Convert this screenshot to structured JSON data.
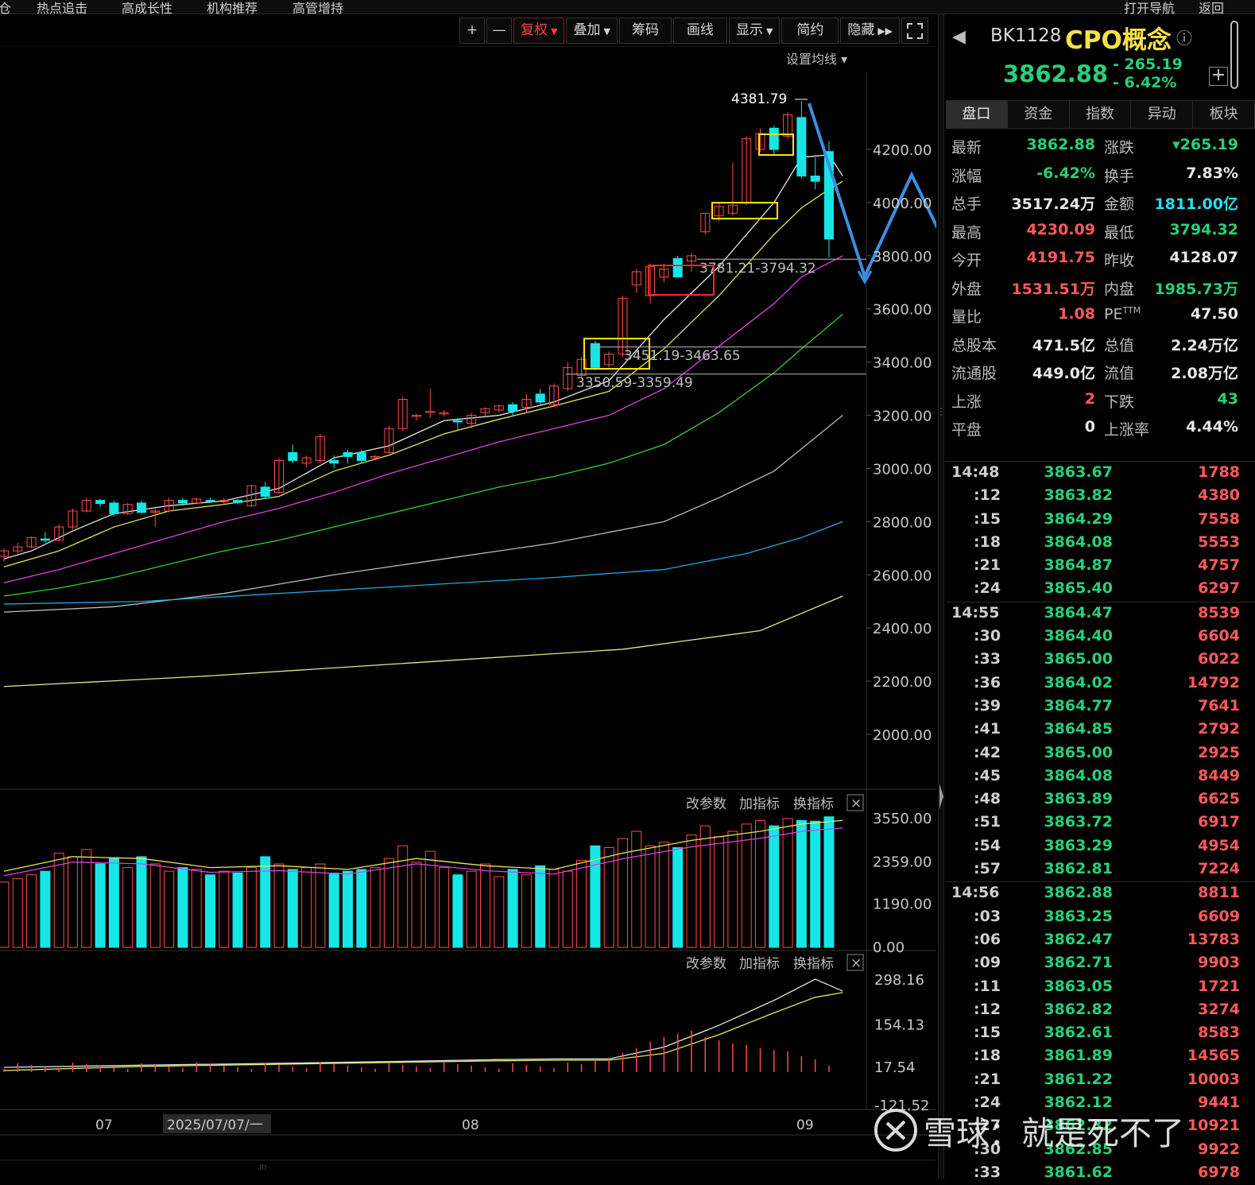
{
  "top_nav": [
    "仓",
    "热点追击",
    "高成长性",
    "机构推荐",
    "高管增持",
    "打开导航",
    "返回"
  ],
  "toolbar": {
    "plus": "+",
    "minus": "—",
    "fuquan": "复权",
    "overlay": "叠加",
    "chips": "筹码",
    "draw": "画线",
    "display": "显示",
    "simple": "简约",
    "hide": "隐藏"
  },
  "main_chart": {
    "set_ma_label": "设置均线",
    "high_label": "4381.79",
    "zone_labels": [
      "3781.21-3794.32",
      "3451.19-3463.65",
      "3350.59-3359.49"
    ],
    "y_ticks": [
      "4200.00",
      "4000.00",
      "3800.00",
      "3600.00",
      "3400.00",
      "3200.00",
      "3000.00",
      "2800.00",
      "2600.00",
      "2400.00",
      "2200.00",
      "2000.00"
    ],
    "x_labels": [
      "07",
      "2025/07/07/一",
      "08",
      "09"
    ]
  },
  "sub_controls": {
    "change_params": "改参数",
    "add_indicator": "加指标",
    "switch_indicator": "换指标",
    "close": "×"
  },
  "volume_panel": {
    "y_ticks": [
      "3550.00",
      "2359.00",
      "1190.00",
      "0.00"
    ]
  },
  "macd_panel": {
    "y_ticks": [
      "298.16",
      "154.13",
      "17.54",
      "-121.52"
    ]
  },
  "chart_data": {
    "type": "candlestick",
    "ylim": [
      1900,
      4450
    ],
    "candles": [
      [
        2670,
        2700,
        2650,
        2690
      ],
      [
        2690,
        2720,
        2680,
        2705
      ],
      [
        2705,
        2745,
        2700,
        2740
      ],
      [
        2735,
        2760,
        2720,
        2730
      ],
      [
        2730,
        2790,
        2725,
        2780
      ],
      [
        2780,
        2850,
        2770,
        2840
      ],
      [
        2840,
        2890,
        2835,
        2880
      ],
      [
        2880,
        2885,
        2855,
        2868
      ],
      [
        2870,
        2880,
        2820,
        2830
      ],
      [
        2830,
        2870,
        2825,
        2865
      ],
      [
        2870,
        2880,
        2830,
        2835
      ],
      [
        2835,
        2850,
        2780,
        2840
      ],
      [
        2840,
        2890,
        2835,
        2880
      ],
      [
        2880,
        2890,
        2860,
        2870
      ],
      [
        2870,
        2890,
        2865,
        2885
      ],
      [
        2880,
        2890,
        2870,
        2875
      ],
      [
        2875,
        2890,
        2865,
        2880
      ],
      [
        2880,
        2885,
        2865,
        2872
      ],
      [
        2860,
        2940,
        2855,
        2935
      ],
      [
        2930,
        2950,
        2885,
        2895
      ],
      [
        2910,
        3040,
        2905,
        3030
      ],
      [
        3060,
        3090,
        3020,
        3030
      ],
      [
        3020,
        3050,
        3005,
        3040
      ],
      [
        3030,
        3130,
        3020,
        3120
      ],
      [
        3030,
        3050,
        3000,
        3020
      ],
      [
        3060,
        3070,
        3020,
        3045
      ],
      [
        3060,
        3070,
        3020,
        3030
      ],
      [
        3040,
        3050,
        3030,
        3045
      ],
      [
        3060,
        3160,
        3055,
        3150
      ],
      [
        3150,
        3270,
        3140,
        3260
      ],
      [
        3200,
        3205,
        3180,
        3200
      ],
      [
        3210,
        3300,
        3190,
        3215
      ],
      [
        3205,
        3220,
        3195,
        3210
      ],
      [
        3180,
        3190,
        3140,
        3175
      ],
      [
        3170,
        3210,
        3150,
        3200
      ],
      [
        3210,
        3230,
        3195,
        3225
      ],
      [
        3220,
        3240,
        3210,
        3235
      ],
      [
        3240,
        3250,
        3200,
        3215
      ],
      [
        3230,
        3280,
        3210,
        3260
      ],
      [
        3280,
        3300,
        3240,
        3250
      ],
      [
        3240,
        3320,
        3230,
        3310
      ],
      [
        3300,
        3400,
        3290,
        3380
      ],
      [
        3350,
        3420,
        3340,
        3410
      ],
      [
        3470,
        3480,
        3370,
        3380
      ],
      [
        3390,
        3440,
        3380,
        3430
      ],
      [
        3430,
        3650,
        3420,
        3640
      ],
      [
        3690,
        3750,
        3660,
        3740
      ],
      [
        3650,
        3770,
        3620,
        3760
      ],
      [
        3720,
        3770,
        3700,
        3750
      ],
      [
        3790,
        3800,
        3720,
        3720
      ],
      [
        3780,
        3810,
        3740,
        3800
      ],
      [
        3890,
        3960,
        3880,
        3960
      ],
      [
        3950,
        4000,
        3930,
        3985
      ],
      [
        3960,
        4150,
        3950,
        3990
      ],
      [
        4000,
        4250,
        3990,
        4240
      ],
      [
        4200,
        4280,
        4190,
        4260
      ],
      [
        4280,
        4290,
        4180,
        4200
      ],
      [
        4250,
        4340,
        4240,
        4330
      ],
      [
        4320,
        4381.79,
        4090,
        4100
      ],
      [
        4100,
        4170,
        4050,
        4080
      ],
      [
        4191.75,
        4230.09,
        3794.32,
        3862.88
      ]
    ],
    "ma": [
      {
        "name": "MA5",
        "color": "#e6e6e6",
        "values": [
          [
            0,
            2660
          ],
          [
            2,
            2690
          ],
          [
            5,
            2765
          ],
          [
            8,
            2830
          ],
          [
            12,
            2860
          ],
          [
            16,
            2878
          ],
          [
            20,
            2925
          ],
          [
            24,
            3040
          ],
          [
            28,
            3085
          ],
          [
            32,
            3180
          ],
          [
            36,
            3200
          ],
          [
            40,
            3250
          ],
          [
            44,
            3330
          ],
          [
            48,
            3560
          ],
          [
            52,
            3760
          ],
          [
            56,
            4000
          ],
          [
            58,
            4170
          ],
          [
            60,
            4180
          ],
          [
            61,
            4100
          ]
        ]
      },
      {
        "name": "MA10",
        "color": "#e6e65a",
        "values": [
          [
            0,
            2630
          ],
          [
            4,
            2690
          ],
          [
            8,
            2780
          ],
          [
            12,
            2840
          ],
          [
            16,
            2865
          ],
          [
            20,
            2895
          ],
          [
            24,
            2990
          ],
          [
            28,
            3050
          ],
          [
            32,
            3130
          ],
          [
            36,
            3185
          ],
          [
            40,
            3235
          ],
          [
            44,
            3290
          ],
          [
            48,
            3450
          ],
          [
            52,
            3650
          ],
          [
            56,
            3880
          ],
          [
            58,
            3980
          ],
          [
            60,
            4050
          ],
          [
            61,
            4080
          ]
        ]
      },
      {
        "name": "MA20",
        "color": "#e040e0",
        "values": [
          [
            0,
            2570
          ],
          [
            4,
            2620
          ],
          [
            8,
            2680
          ],
          [
            12,
            2740
          ],
          [
            16,
            2800
          ],
          [
            20,
            2850
          ],
          [
            24,
            2910
          ],
          [
            28,
            2980
          ],
          [
            32,
            3040
          ],
          [
            36,
            3100
          ],
          [
            40,
            3150
          ],
          [
            44,
            3200
          ],
          [
            48,
            3300
          ],
          [
            52,
            3460
          ],
          [
            56,
            3620
          ],
          [
            58,
            3720
          ],
          [
            61,
            3800
          ]
        ]
      },
      {
        "name": "MA30",
        "color": "#2fd22f",
        "values": [
          [
            0,
            2520
          ],
          [
            4,
            2550
          ],
          [
            8,
            2590
          ],
          [
            12,
            2640
          ],
          [
            16,
            2690
          ],
          [
            20,
            2730
          ],
          [
            24,
            2780
          ],
          [
            28,
            2830
          ],
          [
            32,
            2880
          ],
          [
            36,
            2930
          ],
          [
            40,
            2970
          ],
          [
            44,
            3020
          ],
          [
            48,
            3090
          ],
          [
            52,
            3210
          ],
          [
            56,
            3360
          ],
          [
            58,
            3450
          ],
          [
            61,
            3580
          ]
        ]
      },
      {
        "name": "MA60",
        "color": "#bdbdbd",
        "values": [
          [
            0,
            2460
          ],
          [
            8,
            2480
          ],
          [
            16,
            2530
          ],
          [
            24,
            2600
          ],
          [
            32,
            2660
          ],
          [
            40,
            2720
          ],
          [
            48,
            2800
          ],
          [
            52,
            2890
          ],
          [
            56,
            2990
          ],
          [
            61,
            3200
          ]
        ]
      },
      {
        "name": "MA120",
        "color": "#1ea8e0",
        "values": [
          [
            0,
            2490
          ],
          [
            10,
            2500
          ],
          [
            20,
            2530
          ],
          [
            30,
            2560
          ],
          [
            40,
            2590
          ],
          [
            48,
            2620
          ],
          [
            54,
            2680
          ],
          [
            58,
            2740
          ],
          [
            61,
            2800
          ]
        ]
      },
      {
        "name": "MA250",
        "color": "#e6e68c",
        "values": [
          [
            0,
            2180
          ],
          [
            15,
            2220
          ],
          [
            30,
            2270
          ],
          [
            45,
            2320
          ],
          [
            55,
            2390
          ],
          [
            61,
            2520
          ]
        ]
      }
    ],
    "volume": [
      [
        1800
      ],
      [
        1900
      ],
      [
        2000
      ],
      [
        2100
      ],
      [
        2600
      ],
      [
        2500
      ],
      [
        2700
      ],
      [
        2300
      ],
      [
        2450
      ],
      [
        2200
      ],
      [
        2500
      ],
      [
        2300
      ],
      [
        2100
      ],
      [
        2200
      ],
      [
        2150
      ],
      [
        2000
      ],
      [
        2100
      ],
      [
        2050
      ],
      [
        2200
      ],
      [
        2500
      ],
      [
        2300
      ],
      [
        2150
      ],
      [
        2200
      ],
      [
        2300
      ],
      [
        2050
      ],
      [
        2100
      ],
      [
        2150
      ],
      [
        2200
      ],
      [
        2450
      ],
      [
        2800
      ],
      [
        2350
      ],
      [
        2650
      ],
      [
        2200
      ],
      [
        2000
      ],
      [
        2100
      ],
      [
        2300
      ],
      [
        1950
      ],
      [
        2150
      ],
      [
        2000
      ],
      [
        2250
      ],
      [
        2150
      ],
      [
        2100
      ],
      [
        2400
      ],
      [
        2800
      ],
      [
        2750
      ],
      [
        3000
      ],
      [
        3200
      ],
      [
        2800
      ],
      [
        2900
      ],
      [
        2750
      ],
      [
        3100
      ],
      [
        3350
      ],
      [
        3050
      ],
      [
        3200
      ],
      [
        3400
      ],
      [
        3500
      ],
      [
        3350
      ],
      [
        3550
      ],
      [
        3500
      ],
      [
        3480
      ],
      [
        3600
      ]
    ],
    "macd_lines": {
      "dif": [
        [
          0,
          15
        ],
        [
          10,
          22
        ],
        [
          20,
          28
        ],
        [
          30,
          35
        ],
        [
          36,
          40
        ],
        [
          40,
          42
        ],
        [
          44,
          42
        ],
        [
          48,
          80
        ],
        [
          52,
          150
        ],
        [
          56,
          230
        ],
        [
          59,
          298
        ],
        [
          61,
          260
        ]
      ],
      "dea": [
        [
          0,
          5
        ],
        [
          10,
          18
        ],
        [
          20,
          25
        ],
        [
          30,
          32
        ],
        [
          36,
          36
        ],
        [
          40,
          38
        ],
        [
          44,
          38
        ],
        [
          48,
          60
        ],
        [
          52,
          120
        ],
        [
          56,
          190
        ],
        [
          59,
          240
        ],
        [
          61,
          255
        ]
      ]
    }
  },
  "quote_panel": {
    "code": "BK1128",
    "name": "CPO概念",
    "price": "3862.88",
    "change": "- 265.19",
    "change_pct": "- 6.42%",
    "add_btn": "+",
    "tabs": [
      "盘口",
      "资金",
      "指数",
      "异动",
      "板块"
    ],
    "rows": [
      {
        "l1": "最新",
        "v1": "3862.88",
        "c1": "#26d07c",
        "l2": "涨跌",
        "v2": "▾265.19",
        "c2": "#26d07c"
      },
      {
        "l1": "涨幅",
        "v1": "-6.42%",
        "c1": "#26d07c",
        "l2": "换手",
        "v2": "7.83%",
        "c2": "#e8e8e8"
      },
      {
        "l1": "总手",
        "v1": "3517.24万",
        "c1": "#e8e8e8",
        "l2": "金额",
        "v2": "1811.00亿",
        "c2": "#27e0f0"
      },
      {
        "l1": "最高",
        "v1": "4230.09",
        "c1": "#ff5a5a",
        "l2": "最低",
        "v2": "3794.32",
        "c2": "#26d07c"
      },
      {
        "l1": "今开",
        "v1": "4191.75",
        "c1": "#ff5a5a",
        "l2": "昨收",
        "v2": "4128.07",
        "c2": "#e8e8e8"
      },
      {
        "l1": "外盘",
        "v1": "1531.51万",
        "c1": "#ff5a5a",
        "l2": "内盘",
        "v2": "1985.73万",
        "c2": "#26d07c"
      },
      {
        "l1": "量比",
        "v1": "1.08",
        "c1": "#ff5a5a",
        "l2": "PE",
        "l2sup": "TTM",
        "v2": "47.50",
        "c2": "#e8e8e8"
      },
      {
        "l1": "总股本",
        "v1": "471.5亿",
        "c1": "#e8e8e8",
        "l2": "总值",
        "v2": "2.24万亿",
        "c2": "#e8e8e8"
      },
      {
        "l1": "流通股",
        "v1": "449.0亿",
        "c1": "#e8e8e8",
        "l2": "流值",
        "v2": "2.08万亿",
        "c2": "#e8e8e8"
      },
      {
        "l1": "上涨",
        "v1": "2",
        "c1": "#ff5a5a",
        "l2": "下跌",
        "v2": "43",
        "c2": "#26d07c"
      },
      {
        "l1": "平盘",
        "v1": "0",
        "c1": "#e8e8e8",
        "l2": "上涨率",
        "v2": "4.44%",
        "c2": "#e8e8e8"
      }
    ],
    "ticks": [
      {
        "t": "14:48",
        "p": "3863.67",
        "v": "1788",
        "sep": false
      },
      {
        "t": ":12",
        "p": "3863.82",
        "v": "4380"
      },
      {
        "t": ":15",
        "p": "3864.29",
        "v": "7558"
      },
      {
        "t": ":18",
        "p": "3864.08",
        "v": "5553"
      },
      {
        "t": ":21",
        "p": "3864.87",
        "v": "4757"
      },
      {
        "t": ":24",
        "p": "3865.40",
        "v": "6297"
      },
      {
        "t": "14:55",
        "p": "3864.47",
        "v": "8539",
        "sep": true
      },
      {
        "t": ":30",
        "p": "3864.40",
        "v": "6604"
      },
      {
        "t": ":33",
        "p": "3865.00",
        "v": "6022"
      },
      {
        "t": ":36",
        "p": "3864.02",
        "v": "14792"
      },
      {
        "t": ":39",
        "p": "3864.77",
        "v": "7641"
      },
      {
        "t": ":41",
        "p": "3864.85",
        "v": "2792"
      },
      {
        "t": ":42",
        "p": "3865.00",
        "v": "2925"
      },
      {
        "t": ":45",
        "p": "3864.08",
        "v": "8449"
      },
      {
        "t": ":48",
        "p": "3863.89",
        "v": "6625"
      },
      {
        "t": ":51",
        "p": "3863.72",
        "v": "6917"
      },
      {
        "t": ":54",
        "p": "3863.29",
        "v": "4954"
      },
      {
        "t": ":57",
        "p": "3862.81",
        "v": "7224"
      },
      {
        "t": "14:56",
        "p": "3862.88",
        "v": "8811",
        "sep": true
      },
      {
        "t": ":03",
        "p": "3863.25",
        "v": "6609"
      },
      {
        "t": ":06",
        "p": "3862.47",
        "v": "13783"
      },
      {
        "t": ":09",
        "p": "3862.71",
        "v": "9903"
      },
      {
        "t": ":11",
        "p": "3863.05",
        "v": "1721"
      },
      {
        "t": ":12",
        "p": "3862.82",
        "v": "3274"
      },
      {
        "t": ":15",
        "p": "3862.61",
        "v": "8583"
      },
      {
        "t": ":18",
        "p": "3861.89",
        "v": "14565"
      },
      {
        "t": ":21",
        "p": "3861.22",
        "v": "10003"
      },
      {
        "t": ":24",
        "p": "3862.12",
        "v": "9441"
      },
      {
        "t": ":27",
        "p": "3862.32",
        "v": "10921"
      },
      {
        "t": ":30",
        "p": "3862.85",
        "v": "9922"
      },
      {
        "t": ":33",
        "p": "3861.62",
        "v": "6978"
      }
    ]
  },
  "watermark": "雪球：就是死不了"
}
